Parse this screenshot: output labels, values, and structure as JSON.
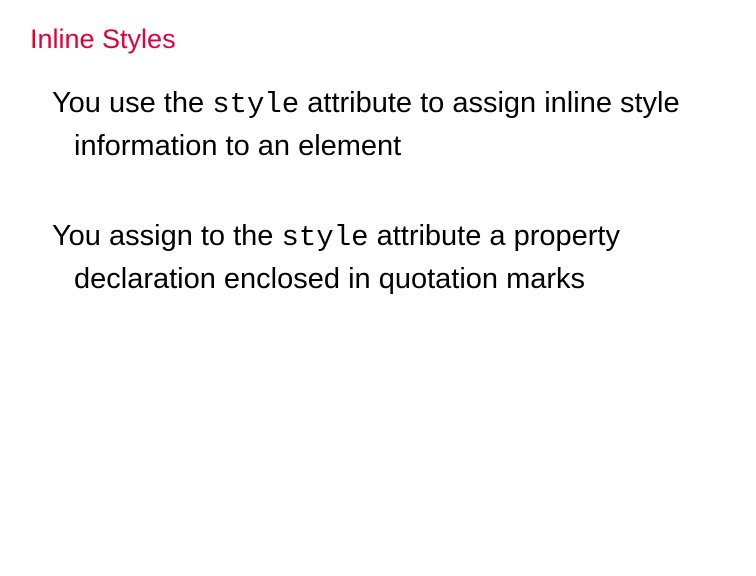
{
  "title": "Inline Styles",
  "para1": {
    "pre": "You use the ",
    "code": "style",
    "post": " attribute to assign inline style information to an element"
  },
  "para2": {
    "pre": "You assign to the ",
    "code": "style",
    "post": " attribute a property declaration enclosed in quotation marks"
  }
}
